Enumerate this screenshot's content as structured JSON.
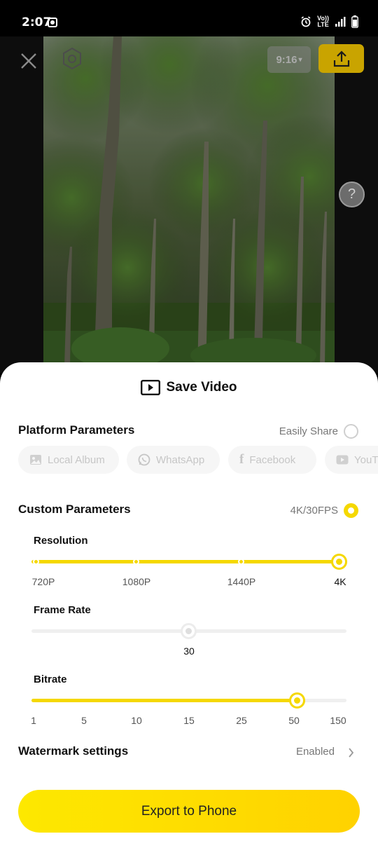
{
  "status_bar": {
    "time": "2:07",
    "network_top": "Vo))",
    "network_bottom": "LTE"
  },
  "preview": {
    "aspect_ratio_label": "9:16",
    "icons": [
      "close-icon",
      "hexagon-icon",
      "upload-icon",
      "help-icon"
    ],
    "help_label": "?"
  },
  "sheet": {
    "title": "Save Video",
    "title_icon": "play-screen-icon",
    "platform": {
      "heading": "Platform Parameters",
      "easily_share_label": "Easily Share",
      "easily_share_checked": false,
      "chips": [
        {
          "label": "Local Album",
          "icon": "gallery-icon"
        },
        {
          "label": "WhatsApp",
          "icon": "whatsapp-icon"
        },
        {
          "label": "Facebook",
          "icon": "facebook-icon"
        },
        {
          "label": "YouTu",
          "icon": "youtube-icon"
        }
      ]
    },
    "custom": {
      "heading": "Custom Parameters",
      "summary": "4K/30FPS",
      "selected": true,
      "resolution": {
        "label": "Resolution",
        "options": [
          "720P",
          "1080P",
          "1440P",
          "4K"
        ],
        "selected": "4K",
        "selected_index": 3
      },
      "frame_rate": {
        "label": "Frame Rate",
        "value": "30",
        "level": 0.5
      },
      "bitrate": {
        "label": "Bitrate",
        "options": [
          "1",
          "5",
          "10",
          "15",
          "25",
          "50",
          "150"
        ],
        "selected": "50",
        "selected_index": 5
      }
    },
    "watermark": {
      "label": "Watermark settings",
      "value": "Enabled"
    },
    "export_button": "Export to Phone"
  },
  "colors": {
    "accent": "#f5d800",
    "export_top_button": "#c9a400",
    "sheet_bg": "#ffffff"
  }
}
